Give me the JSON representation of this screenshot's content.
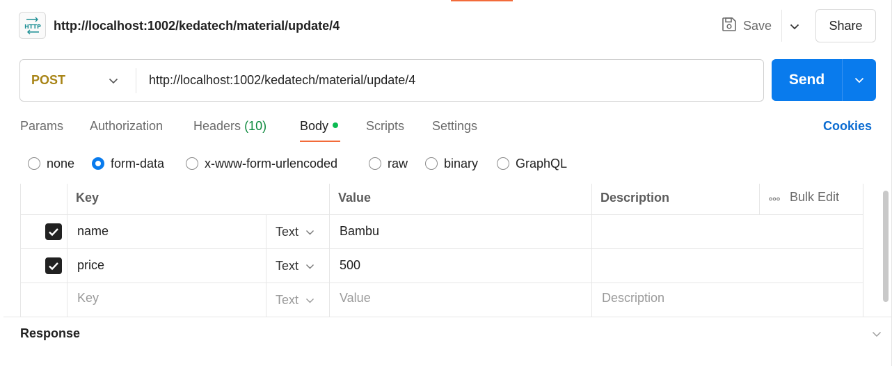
{
  "header": {
    "title": "http://localhost:1002/kedatech/material/update/4",
    "save_label": "Save",
    "share_label": "Share"
  },
  "request": {
    "method": "POST",
    "url": "http://localhost:1002/kedatech/material/update/4",
    "send_label": "Send"
  },
  "tabs": {
    "params": "Params",
    "authorization": "Authorization",
    "headers": "Headers",
    "headers_count": "(10)",
    "body": "Body",
    "scripts": "Scripts",
    "settings": "Settings",
    "cookies": "Cookies"
  },
  "body_modes": {
    "none": "none",
    "form_data": "form-data",
    "urlencoded": "x-www-form-urlencoded",
    "raw": "raw",
    "binary": "binary",
    "graphql": "GraphQL",
    "selected": "form-data"
  },
  "table": {
    "headers": {
      "key": "Key",
      "value": "Value",
      "description": "Description",
      "bulk_edit": "Bulk Edit"
    },
    "rows": [
      {
        "checked": true,
        "key": "name",
        "type": "Text",
        "value": "Bambu",
        "description": ""
      },
      {
        "checked": true,
        "key": "price",
        "type": "Text",
        "value": "500",
        "description": ""
      }
    ],
    "placeholder": {
      "key": "Key",
      "type": "Text",
      "value": "Value",
      "description": "Description"
    }
  },
  "response": {
    "label": "Response"
  },
  "colors": {
    "accent_orange": "#f26b3a",
    "send_blue": "#097bed",
    "method_post": "#a88416",
    "headers_count_green": "#0e8a3e",
    "body_dot_green": "#0cbb52",
    "cookies_link": "#0a6bd1"
  },
  "icons": {
    "http": "http-request-icon",
    "save": "floppy-disk-icon",
    "caret": "chevron-down-icon",
    "checkbox": "checkmark-icon",
    "more": "ellipsis-icon"
  }
}
